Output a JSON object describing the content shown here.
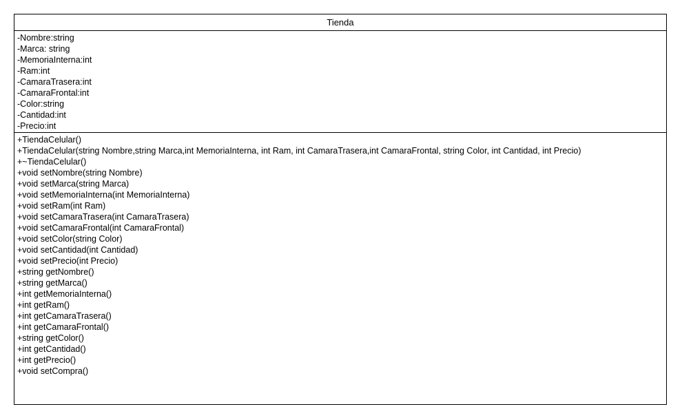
{
  "class_name": "Tienda",
  "attributes": [
    "-Nombre:string",
    "-Marca: string",
    "-MemoriaInterna:int",
    "-Ram:int",
    "-CamaraTrasera:int",
    "-CamaraFrontal:int",
    "-Color:string",
    "-Cantidad:int",
    "-Precio:int"
  ],
  "methods": [
    "+TiendaCelular()",
    "+TiendaCelular(string Nombre,string Marca,int MemoriaInterna, int Ram, int CamaraTrasera,int CamaraFrontal, string Color, int Cantidad, int Precio)",
    "+~TiendaCelular()",
    "+void setNombre(string Nombre)",
    "+void setMarca(string Marca)",
    "+void setMemoriaInterna(int MemoriaInterna)",
    "+void setRam(int Ram)",
    "+void setCamaraTrasera(int CamaraTrasera)",
    "+void setCamaraFrontal(int CamaraFrontal)",
    "+void setColor(string Color)",
    "+void setCantidad(int Cantidad)",
    "+void setPrecio(int Precio)",
    "+string getNombre()",
    "+string getMarca()",
    "+int getMemoriaInterna()",
    "+int getRam()",
    "+int getCamaraTrasera()",
    "+int getCamaraFrontal()",
    "+string getColor()",
    "+int getCantidad()",
    "+int getPrecio()",
    "+void setCompra()"
  ]
}
